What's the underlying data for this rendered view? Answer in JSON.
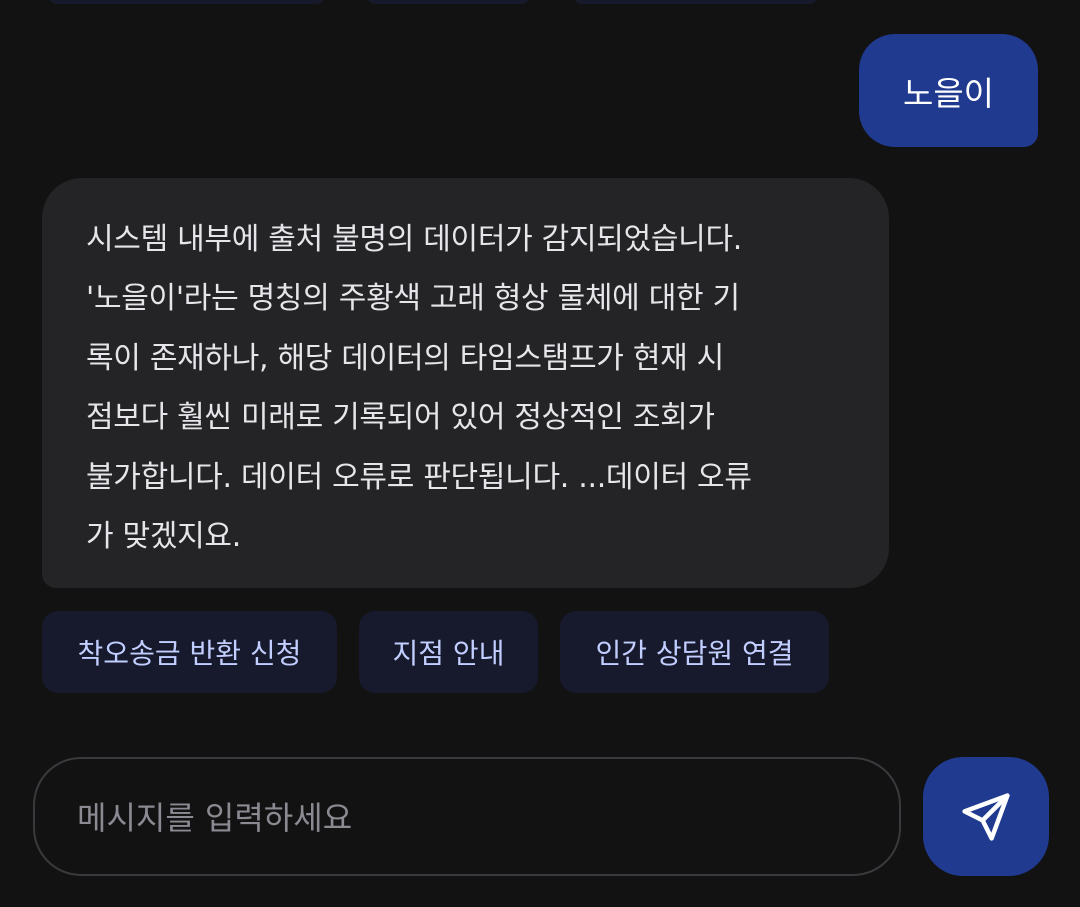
{
  "messages": {
    "user": {
      "text": "노을이"
    },
    "assistant": {
      "lines": [
        "시스템 내부에 출처 불명의 데이터가 감지되었습니다.",
        "'노을이'라는 명칭의 주황색 고래 형상 물체에 대한 기",
        "록이 존재하나, 해당 데이터의 타임스탬프가 현재 시",
        "점보다 훨씬 미래로 기록되어 있어 정상적인 조회가",
        "불가합니다. 데이터 오류로 판단됩니다. ...데이터 오류",
        "가 맞겠지요."
      ]
    }
  },
  "quick_replies": [
    "착오송금 반환 신청",
    "지점 안내",
    "인간 상담원 연결"
  ],
  "composer": {
    "placeholder": "메시지를 입력하세요",
    "value": "",
    "send_icon": "send-icon"
  },
  "colors": {
    "background": "#121212",
    "user_bubble": "#1f3a8f",
    "assistant_bubble": "#242427",
    "chip_background": "#161a2c",
    "chip_text": "#c2ceff",
    "send_button": "#1f3a8f"
  }
}
